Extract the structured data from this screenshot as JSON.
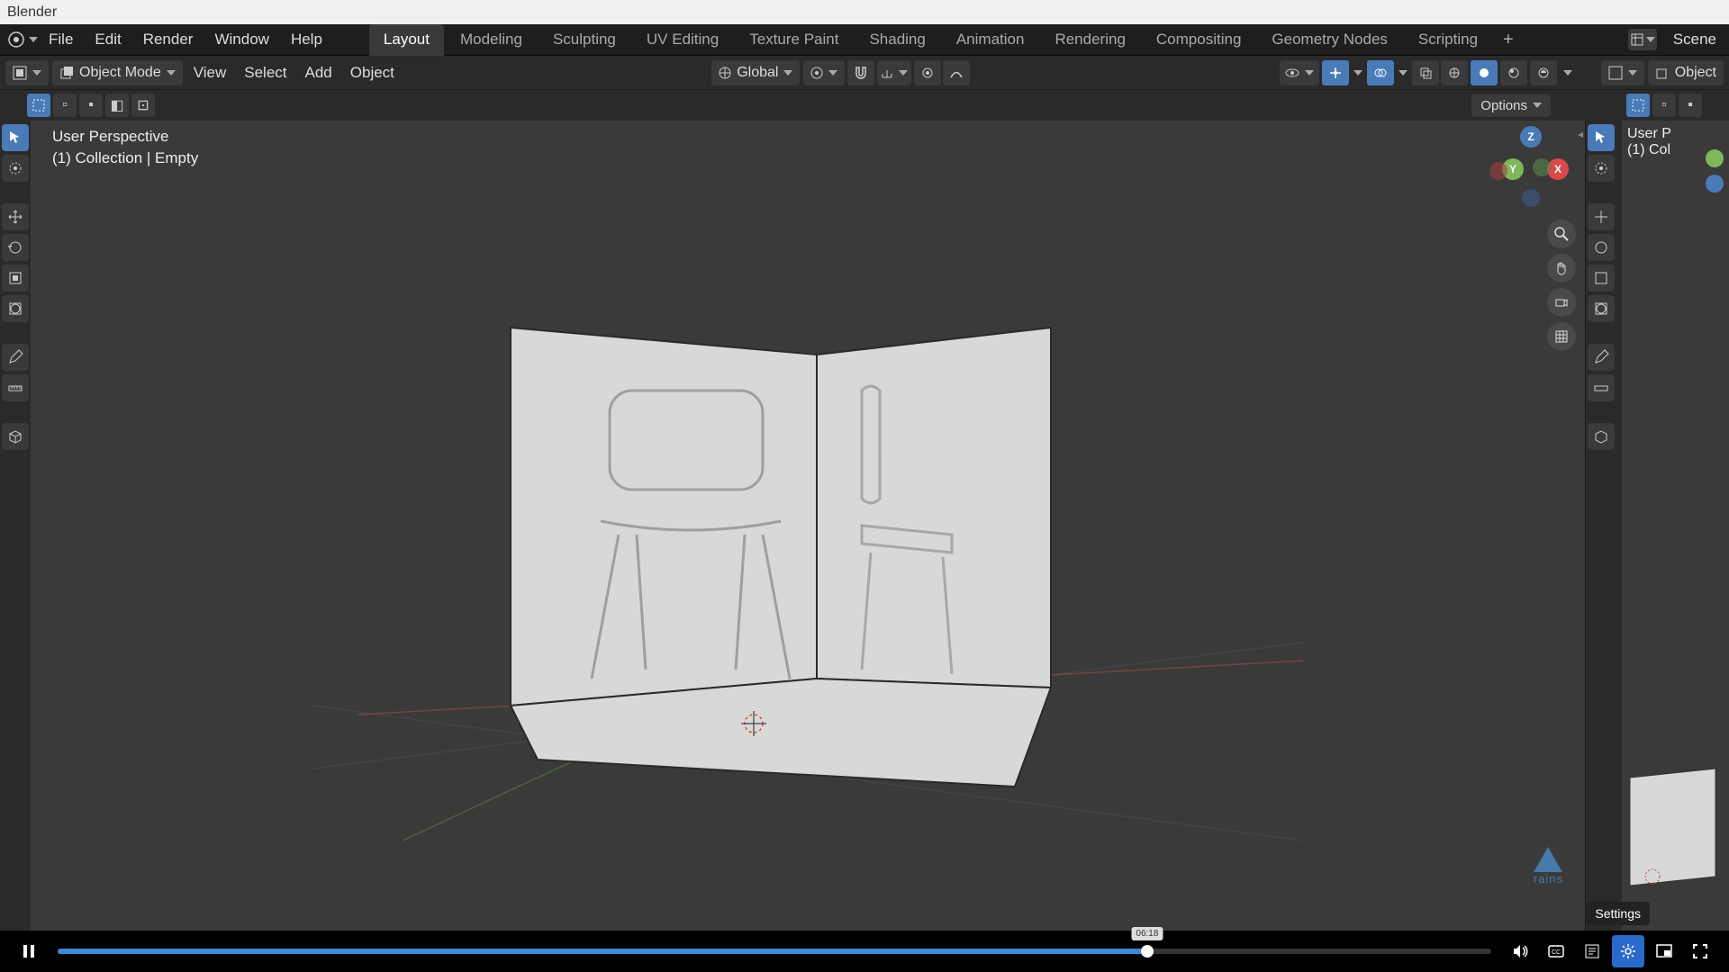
{
  "app": {
    "title": "Blender"
  },
  "menu": {
    "items": [
      "File",
      "Edit",
      "Render",
      "Window",
      "Help"
    ]
  },
  "workspaces": {
    "tabs": [
      "Layout",
      "Modeling",
      "Sculpting",
      "UV Editing",
      "Texture Paint",
      "Shading",
      "Animation",
      "Rendering",
      "Compositing",
      "Geometry Nodes",
      "Scripting"
    ],
    "active": 0
  },
  "scene": {
    "label": "Scene"
  },
  "toolbar": {
    "mode": "Object Mode",
    "view": "View",
    "select": "Select",
    "add": "Add",
    "object": "Object",
    "orientation": "Global",
    "options": "Options",
    "right_label": "Object"
  },
  "viewport": {
    "line1": "User Perspective",
    "line2": "(1) Collection | Empty",
    "line1b": "User P",
    "line2b": "(1) Col"
  },
  "gizmo": {
    "x": "X",
    "y": "Y",
    "z": "Z"
  },
  "video": {
    "time": "06:18",
    "tooltip": "Settings"
  },
  "watermark": "rains"
}
